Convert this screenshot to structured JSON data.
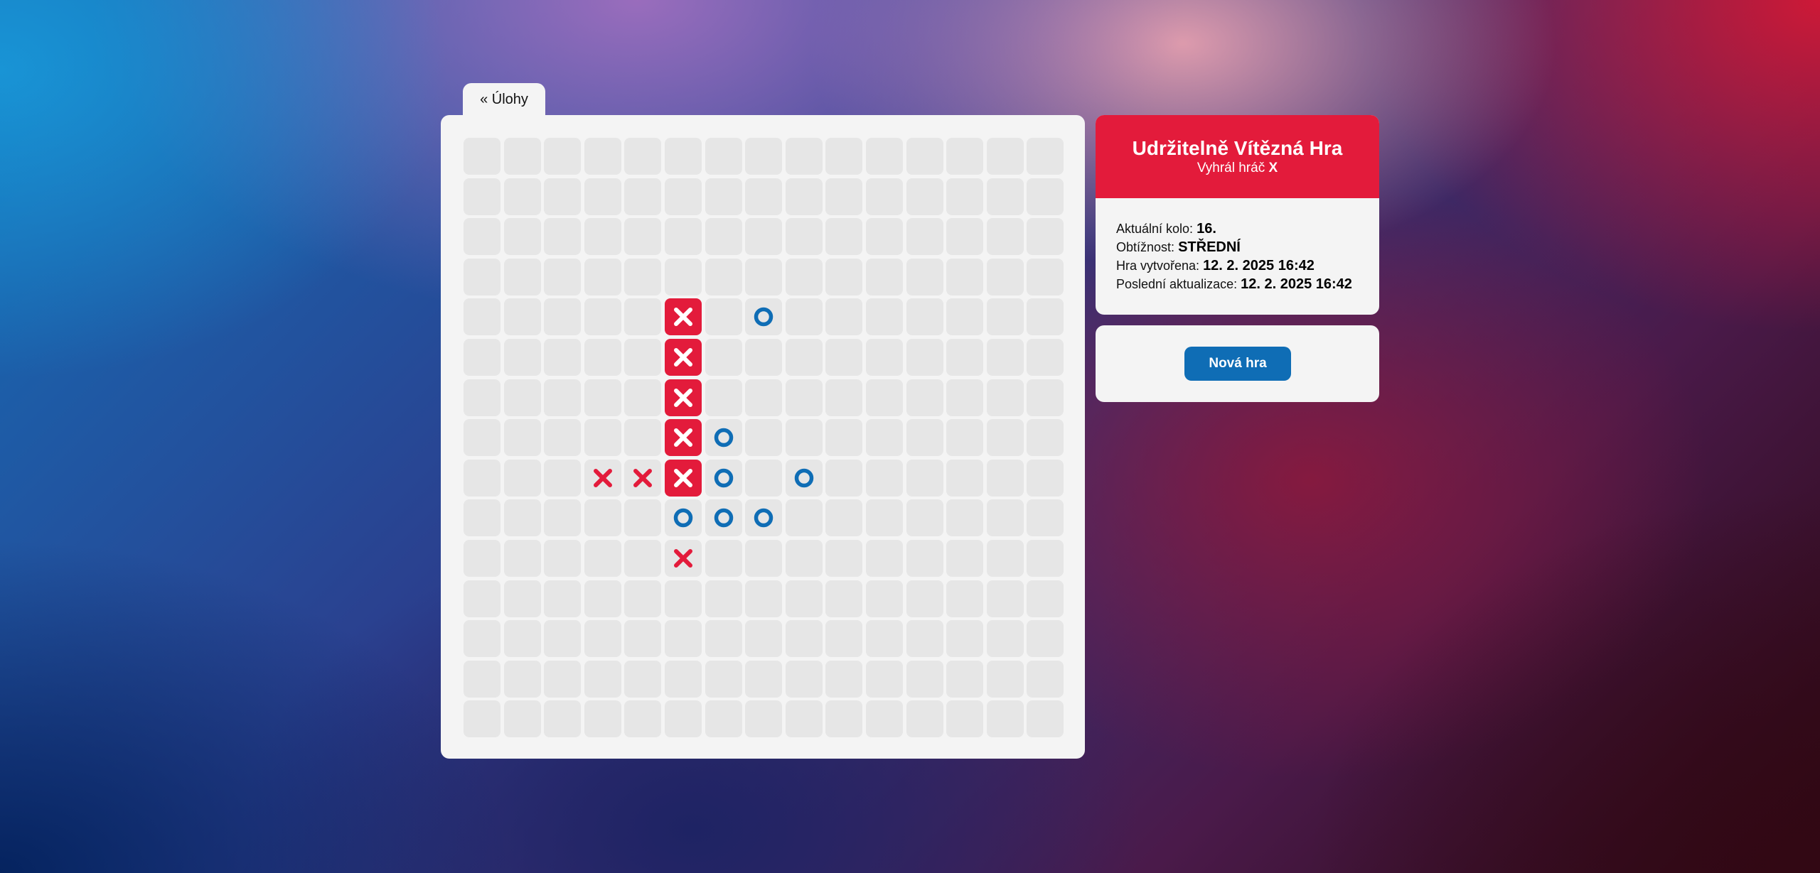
{
  "nav": {
    "back_label": "« Úlohy"
  },
  "game": {
    "title": "Udržitelně Vítězná Hra",
    "result_prefix": "Vyhrál hráč",
    "winner": "X",
    "round_label": "Aktuální kolo:",
    "round_value": "16.",
    "difficulty_label": "Obtížnost:",
    "difficulty_value": "STŘEDNÍ",
    "created_label": "Hra vytvořena:",
    "created_value": "12. 2. 2025 16:42",
    "updated_label": "Poslední aktualizace:",
    "updated_value": "12. 2. 2025 16:42"
  },
  "actions": {
    "new_game_label": "Nová hra"
  },
  "board": {
    "rows": 15,
    "cols": 15,
    "marks": [
      {
        "row": 4,
        "col": 5,
        "symbol": "X",
        "winning": true
      },
      {
        "row": 4,
        "col": 7,
        "symbol": "O",
        "winning": false
      },
      {
        "row": 5,
        "col": 5,
        "symbol": "X",
        "winning": true
      },
      {
        "row": 6,
        "col": 5,
        "symbol": "X",
        "winning": true
      },
      {
        "row": 7,
        "col": 5,
        "symbol": "X",
        "winning": true
      },
      {
        "row": 7,
        "col": 6,
        "symbol": "O",
        "winning": false
      },
      {
        "row": 8,
        "col": 3,
        "symbol": "X",
        "winning": false
      },
      {
        "row": 8,
        "col": 4,
        "symbol": "X",
        "winning": false
      },
      {
        "row": 8,
        "col": 5,
        "symbol": "X",
        "winning": true
      },
      {
        "row": 8,
        "col": 6,
        "symbol": "O",
        "winning": false
      },
      {
        "row": 8,
        "col": 8,
        "symbol": "O",
        "winning": false
      },
      {
        "row": 9,
        "col": 5,
        "symbol": "O",
        "winning": false
      },
      {
        "row": 9,
        "col": 6,
        "symbol": "O",
        "winning": false
      },
      {
        "row": 9,
        "col": 7,
        "symbol": "O",
        "winning": false
      },
      {
        "row": 10,
        "col": 5,
        "symbol": "X",
        "winning": false
      }
    ]
  },
  "colors": {
    "x_mark": "#e31b3b",
    "o_mark": "#0f6db5",
    "win_cell": "#e31b3b",
    "empty_cell": "#e6e6e6",
    "panel": "#f4f4f4"
  },
  "icons": {
    "x": "cross-mark-icon",
    "o": "circle-mark-icon"
  }
}
